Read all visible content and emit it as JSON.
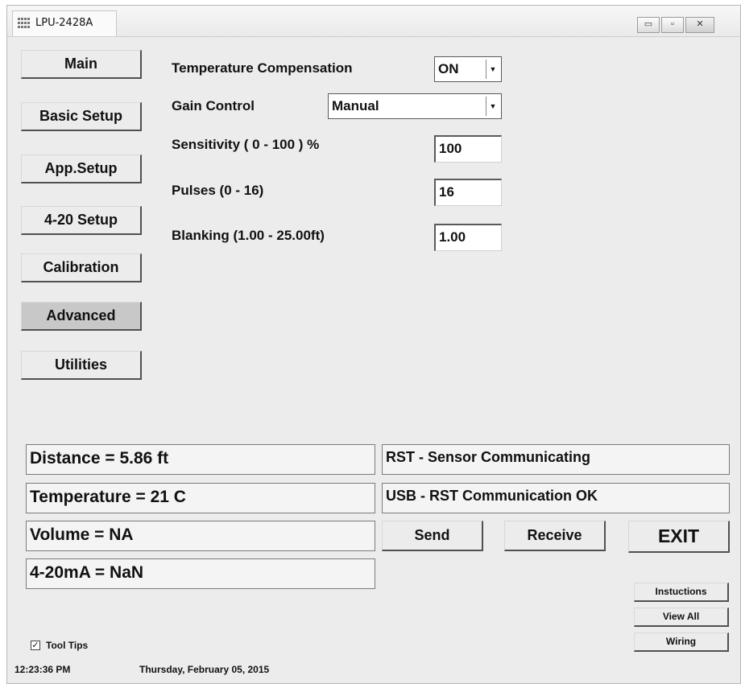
{
  "window": {
    "title": "LPU-2428A",
    "controls": {
      "minimize": "▭",
      "maximize": "▫",
      "close": "✕"
    }
  },
  "nav": [
    {
      "label": "Main",
      "active": false
    },
    {
      "label": "Basic Setup",
      "active": false
    },
    {
      "label": "App.Setup",
      "active": false
    },
    {
      "label": "4-20 Setup",
      "active": false
    },
    {
      "label": "Calibration",
      "active": false
    },
    {
      "label": "Advanced",
      "active": true
    },
    {
      "label": "Utilities",
      "active": false
    }
  ],
  "settings": {
    "temp_comp": {
      "label": "Temperature Compensation",
      "value": "ON"
    },
    "gain": {
      "label": "Gain Control",
      "value": "Manual"
    },
    "sensitivity": {
      "label": "Sensitivity ( 0 - 100 ) %",
      "value": "100"
    },
    "pulses": {
      "label": "Pulses (0 - 16)",
      "value": "16"
    },
    "blanking": {
      "label": "Blanking (1.00 - 25.00ft)",
      "value": "1.00"
    }
  },
  "readings": {
    "distance": "Distance = 5.86 ft",
    "temperature": "Temperature = 21 C",
    "volume": "Volume = NA",
    "current": "4-20mA = NaN"
  },
  "status": {
    "sensor": "RST - Sensor Communicating",
    "usb": "USB - RST Communication OK"
  },
  "actions": {
    "send": "Send",
    "receive": "Receive",
    "exit": "EXIT"
  },
  "side_buttons": {
    "instructions": "Instuctions",
    "view_all": "View All",
    "wiring": "Wiring"
  },
  "tooltips": {
    "label": "Tool Tips",
    "checked": true,
    "mark": "✓"
  },
  "footer": {
    "time": "12:23:36 PM",
    "date": "Thursday, February 05, 2015"
  },
  "icons": {
    "dropdown": "dropdown-arrow-icon",
    "app": "grid-app-icon"
  },
  "colors": {
    "window_bg": "#ececec",
    "active_button": "#c8c8c8"
  }
}
